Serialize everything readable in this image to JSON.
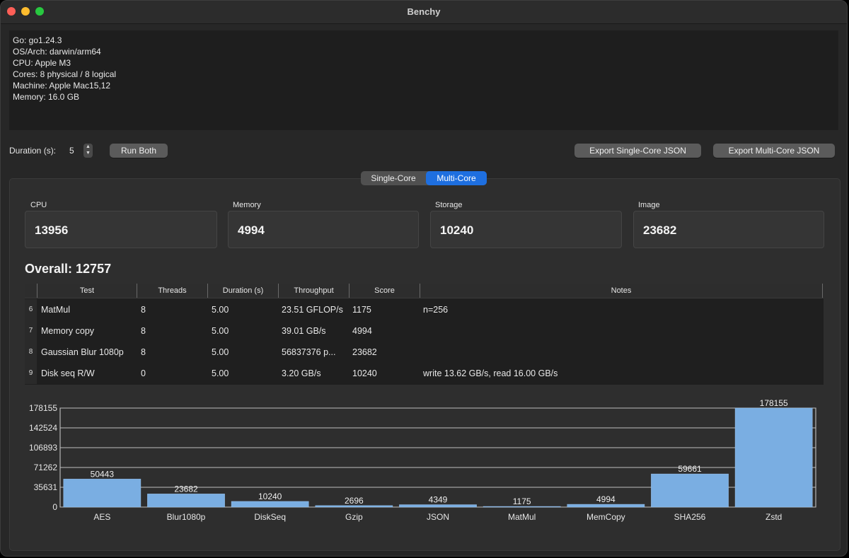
{
  "window": {
    "title": "Benchy"
  },
  "sysinfo": {
    "lines": [
      "Go: go1.24.3",
      "OS/Arch: darwin/arm64",
      "CPU:  Apple M3",
      "Cores: 8 physical / 8 logical",
      "Machine: Apple Mac15,12",
      "Memory: 16.0 GB"
    ]
  },
  "controls": {
    "duration_label": "Duration (s):",
    "duration_value": "5",
    "run_both": "Run Both",
    "export_single": "Export Single-Core JSON",
    "export_multi": "Export Multi-Core JSON"
  },
  "tabs": [
    {
      "label": "Single-Core",
      "selected": false
    },
    {
      "label": "Multi-Core",
      "selected": true
    }
  ],
  "scores": [
    {
      "label": "CPU",
      "value": "13956"
    },
    {
      "label": "Memory",
      "value": "4994"
    },
    {
      "label": "Storage",
      "value": "10240"
    },
    {
      "label": "Image",
      "value": "23682"
    }
  ],
  "overall": "Overall: 12757",
  "table": {
    "columns": [
      "Test",
      "Threads",
      "Duration (s)",
      "Throughput",
      "Score",
      "Notes"
    ],
    "rows": [
      {
        "n": "6",
        "test": "MatMul",
        "threads": "8",
        "duration": "5.00",
        "throughput": "23.51 GFLOP/s",
        "score": "1175",
        "notes": "n=256"
      },
      {
        "n": "7",
        "test": "Memory copy",
        "threads": "8",
        "duration": "5.00",
        "throughput": "39.01 GB/s",
        "score": "4994",
        "notes": ""
      },
      {
        "n": "8",
        "test": "Gaussian Blur 1080p",
        "threads": "8",
        "duration": "5.00",
        "throughput": "56837376 p...",
        "score": "23682",
        "notes": ""
      },
      {
        "n": "9",
        "test": "Disk seq R/W",
        "threads": "0",
        "duration": "5.00",
        "throughput": "3.20 GB/s",
        "score": "10240",
        "notes": "write 13.62 GB/s, read 16.00 GB/s"
      }
    ]
  },
  "colors": {
    "accent": "#1e6fe0",
    "bar": "#7aaee2"
  },
  "chart_data": {
    "type": "bar",
    "categories": [
      "AES",
      "Blur1080p",
      "DiskSeq",
      "Gzip",
      "JSON",
      "MatMul",
      "MemCopy",
      "SHA256",
      "Zstd"
    ],
    "values": [
      50443,
      23682,
      10240,
      2696,
      4349,
      1175,
      4994,
      59661,
      178155
    ],
    "data_labels": [
      "50443",
      "23682",
      "10240",
      "2696",
      "4349",
      "1175",
      "4994",
      "59661",
      "178155"
    ],
    "ytick_labels": [
      "0",
      "35631",
      "71262",
      "106893",
      "142524",
      "178155"
    ],
    "ylim": [
      0,
      178155
    ],
    "grid": true
  }
}
